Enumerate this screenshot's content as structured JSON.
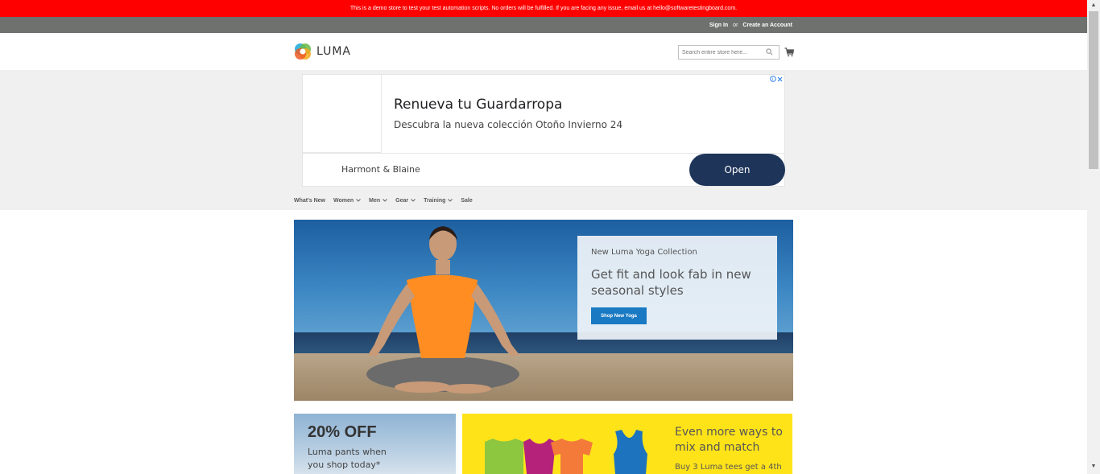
{
  "demo_banner": {
    "text": "This is a demo store to test your test automation scripts. No orders will be fulfilled. If you are facing any issue, email us at hello@softwaretestingboard.com."
  },
  "top_panel": {
    "sign_in": "Sign In",
    "or": "or",
    "create_account": "Create an Account"
  },
  "header": {
    "logo_text": "LUMA",
    "search_placeholder": "Search entire store here..."
  },
  "ad": {
    "title": "Renueva tu Guardarropa",
    "description": "Descubra la nueva colección Otoño Invierno 24",
    "advertiser": "Harmont & Blaine",
    "button": "Open"
  },
  "nav": {
    "items": [
      {
        "label": "What's New",
        "has_dropdown": false
      },
      {
        "label": "Women",
        "has_dropdown": true
      },
      {
        "label": "Men",
        "has_dropdown": true
      },
      {
        "label": "Gear",
        "has_dropdown": true
      },
      {
        "label": "Training",
        "has_dropdown": true
      },
      {
        "label": "Sale",
        "has_dropdown": false
      }
    ]
  },
  "hero": {
    "subtitle": "New Luma Yoga Collection",
    "title": "Get fit and look fab in new seasonal styles",
    "button": "Shop New Yoga"
  },
  "promo_left": {
    "title": "20% OFF",
    "text": "Luma pants when you shop today*"
  },
  "promo_right": {
    "title": "Even more ways to mix and match",
    "text": "Buy 3 Luma tees get a 4th"
  },
  "colors": {
    "banner": "#ff0000",
    "top_panel": "#6e716e",
    "primary_button": "#1979c3",
    "ad_button": "#1e3459",
    "promo_yellow": "#ffe319"
  }
}
